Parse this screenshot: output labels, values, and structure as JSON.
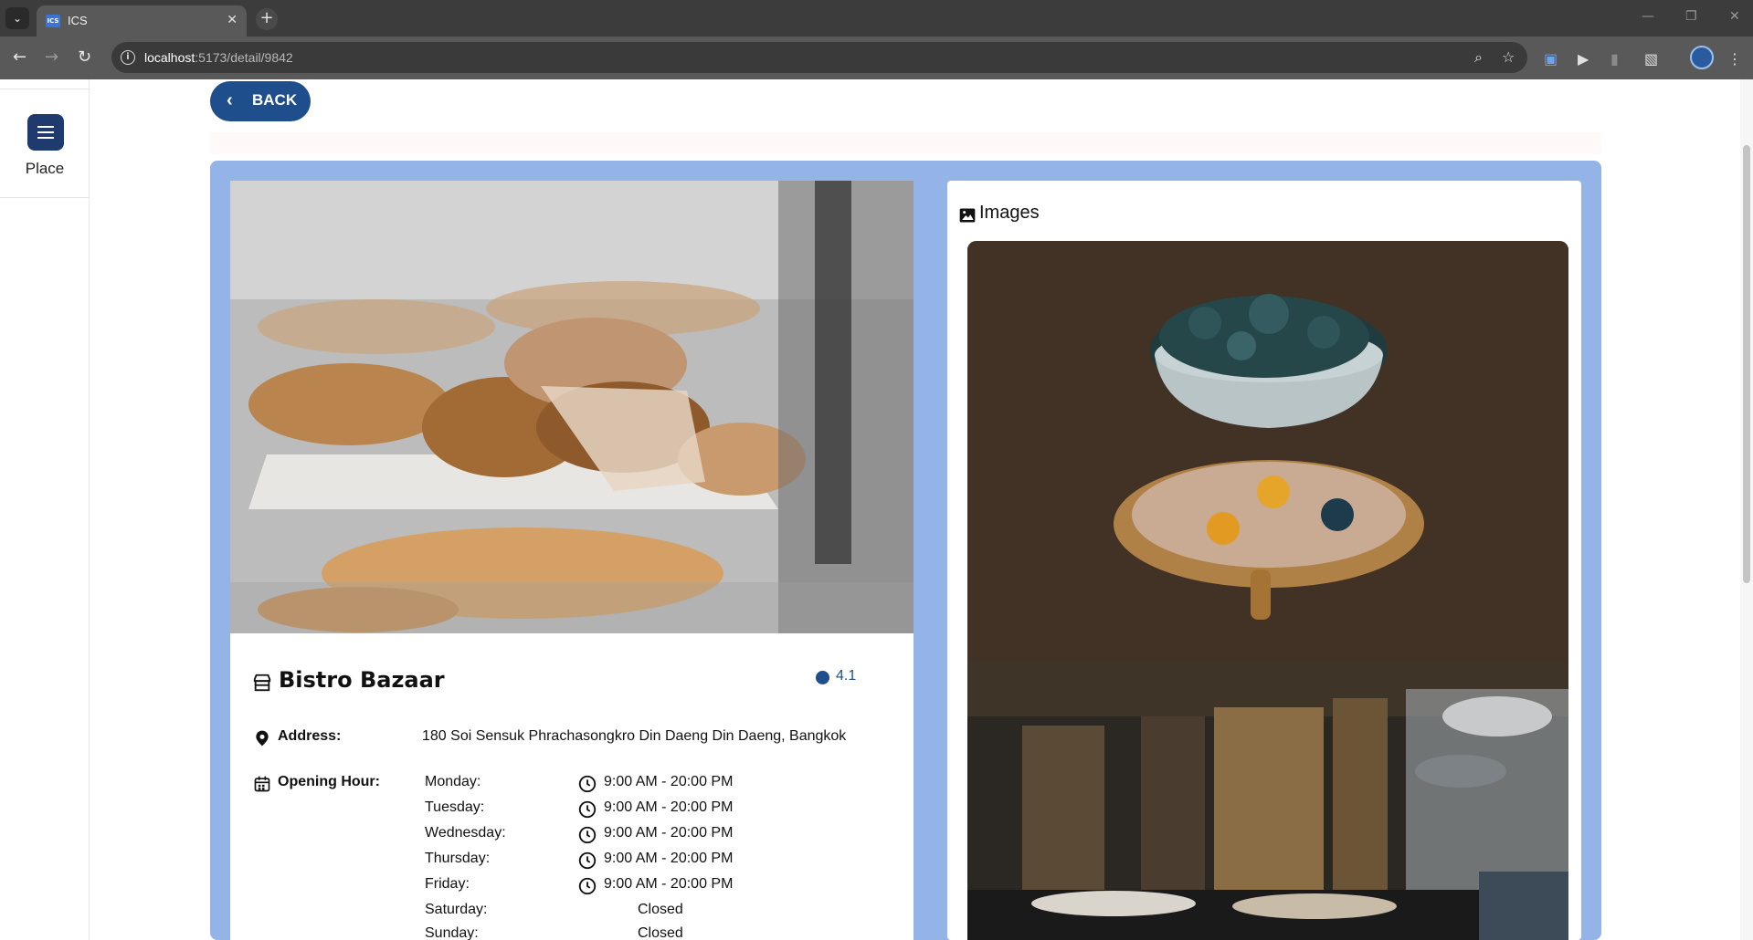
{
  "browser": {
    "tab_title": "ICS",
    "favicon_text": "ICS",
    "url_host": "localhost",
    "url_path": ":5173/detail/9842"
  },
  "sidebar": {
    "items": [
      {
        "label": "Place",
        "icon": "list-icon"
      }
    ]
  },
  "page": {
    "back_label": "BACK",
    "place": {
      "name": "Bistro Bazaar",
      "rating": "4.1",
      "address_label": "Address:",
      "address": "180 Soi Sensuk Phrachasongkro Din Daeng Din Daeng, Bangkok",
      "opening_label": "Opening Hour:",
      "hours": [
        {
          "day": "Monday:",
          "time": "9:00 AM - 20:00 PM",
          "open": true
        },
        {
          "day": "Tuesday:",
          "time": "9:00 AM - 20:00 PM",
          "open": true
        },
        {
          "day": "Wednesday:",
          "time": "9:00 AM - 20:00 PM",
          "open": true
        },
        {
          "day": "Thursday:",
          "time": "9:00 AM - 20:00 PM",
          "open": true
        },
        {
          "day": "Friday:",
          "time": "9:00 AM - 20:00 PM",
          "open": true
        },
        {
          "day": "Saturday:",
          "time": "Closed",
          "open": false
        },
        {
          "day": "Sunday:",
          "time": "Closed",
          "open": false
        }
      ]
    },
    "images_title": "Images"
  },
  "colors": {
    "accent": "#1e4e8c",
    "card_background": "#94b3e6",
    "sidebar_icon": "#1e3a6e"
  }
}
